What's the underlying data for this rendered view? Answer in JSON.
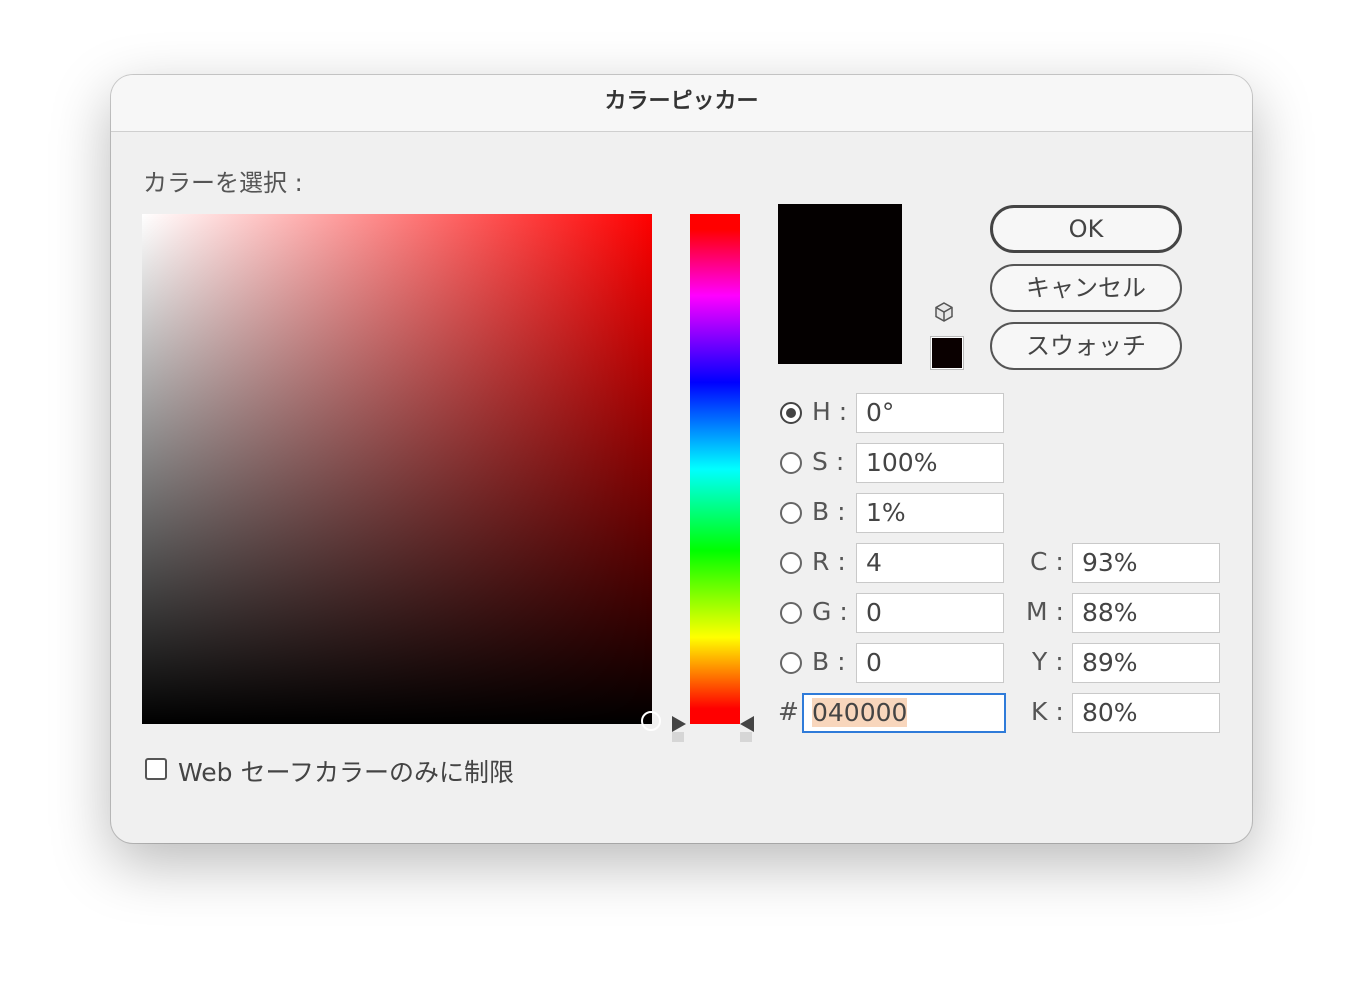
{
  "dialog": {
    "title": "カラーピッカー",
    "select_label": "カラーを選択 :",
    "current_color": "#040000"
  },
  "buttons": {
    "ok": "OK",
    "cancel": "キャンセル",
    "swatches": "スウォッチ"
  },
  "hsb": [
    {
      "key": "H",
      "label": "H :",
      "value": "0°",
      "selected": true
    },
    {
      "key": "S",
      "label": "S :",
      "value": "100%",
      "selected": false
    },
    {
      "key": "B",
      "label": "B :",
      "value": "1%",
      "selected": false
    }
  ],
  "rgb": [
    {
      "key": "R",
      "label": "R :",
      "value": "4",
      "selected": false
    },
    {
      "key": "G",
      "label": "G :",
      "value": "0",
      "selected": false
    },
    {
      "key": "B",
      "label": "B :",
      "value": "0",
      "selected": false
    }
  ],
  "hex": {
    "label": "#",
    "value": "040000"
  },
  "cmyk": [
    {
      "label": "C :",
      "value": "93%"
    },
    {
      "label": "M :",
      "value": "88%"
    },
    {
      "label": "Y :",
      "value": "89%"
    },
    {
      "label": "K :",
      "value": "80%"
    }
  ],
  "web_only": {
    "label": "Web セーフカラーのみに制限",
    "checked": false
  },
  "icons": {
    "out_of_gamut": "cube-icon"
  }
}
